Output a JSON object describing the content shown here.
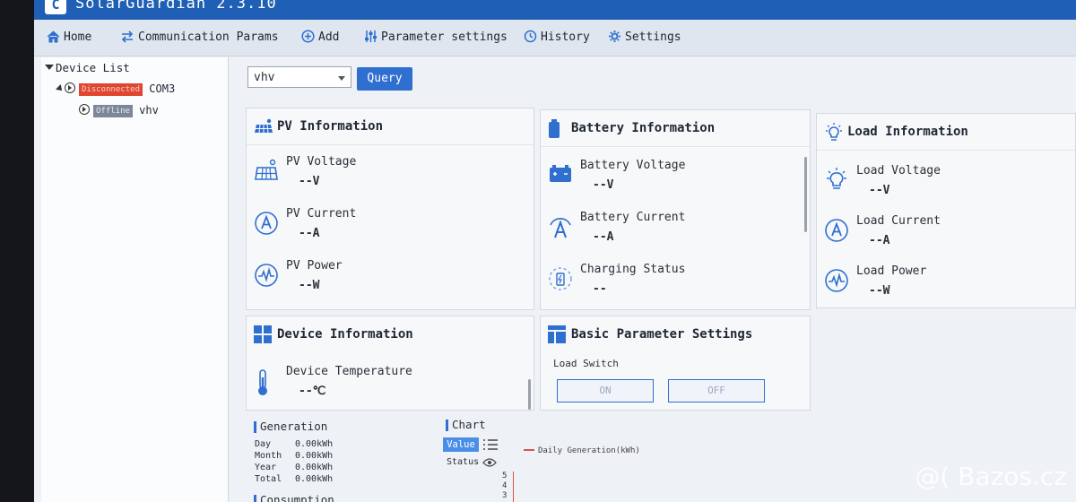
{
  "app": {
    "title": "SolarGuardian 2.3.10",
    "logo": "C"
  },
  "menu": [
    {
      "label": "Home",
      "icon": "home-icon"
    },
    {
      "label": "Communication Params",
      "icon": "swap-arrows-icon"
    },
    {
      "label": "Add",
      "icon": "add-circle-icon"
    },
    {
      "label": "Parameter settings",
      "icon": "sliders-icon"
    },
    {
      "label": "History",
      "icon": "history-icon"
    },
    {
      "label": "Settings",
      "icon": "gear-icon"
    }
  ],
  "sidebar": {
    "title": "Device List",
    "items": [
      {
        "status": "Disconnected",
        "name": "COM3"
      },
      {
        "status": "Offline",
        "name": "vhv"
      }
    ]
  },
  "toolbar": {
    "device_select": "vhv",
    "query_label": "Query"
  },
  "pv": {
    "title": "PV Information",
    "rows": [
      {
        "label": "PV Voltage",
        "value": "--V"
      },
      {
        "label": "PV Current",
        "value": "--A"
      },
      {
        "label": "PV Power",
        "value": "--W"
      }
    ]
  },
  "battery": {
    "title": "Battery Information",
    "rows": [
      {
        "label": "Battery Voltage",
        "value": "--V"
      },
      {
        "label": "Battery Current",
        "value": "--A"
      },
      {
        "label": "Charging Status",
        "value": "--"
      }
    ]
  },
  "load": {
    "title": "Load Information",
    "rows": [
      {
        "label": "Load Voltage",
        "value": "--V"
      },
      {
        "label": "Load Current",
        "value": "--A"
      },
      {
        "label": "Load Power",
        "value": "--W"
      }
    ]
  },
  "device": {
    "title": "Device Information",
    "rows": [
      {
        "label": "Device Temperature",
        "value": "--℃"
      }
    ]
  },
  "basic": {
    "title": "Basic Parameter Settings",
    "switch_label": "Load Switch",
    "on_label": "ON",
    "off_label": "OFF"
  },
  "generation": {
    "title": "Generation",
    "rows": [
      {
        "label": "Day",
        "value": "0.00kWh"
      },
      {
        "label": "Month",
        "value": "0.00kWh"
      },
      {
        "label": "Year",
        "value": "0.00kWh"
      },
      {
        "label": "Total",
        "value": "0.00kWh"
      }
    ]
  },
  "consumption": {
    "title": "Consumption"
  },
  "chart": {
    "title": "Chart",
    "value_tab": "Value",
    "status_label": "Status",
    "legend": "Daily Generation(kWh)",
    "yticks": [
      "5",
      "4",
      "3"
    ]
  },
  "watermark": "@( Bazos.cz"
}
